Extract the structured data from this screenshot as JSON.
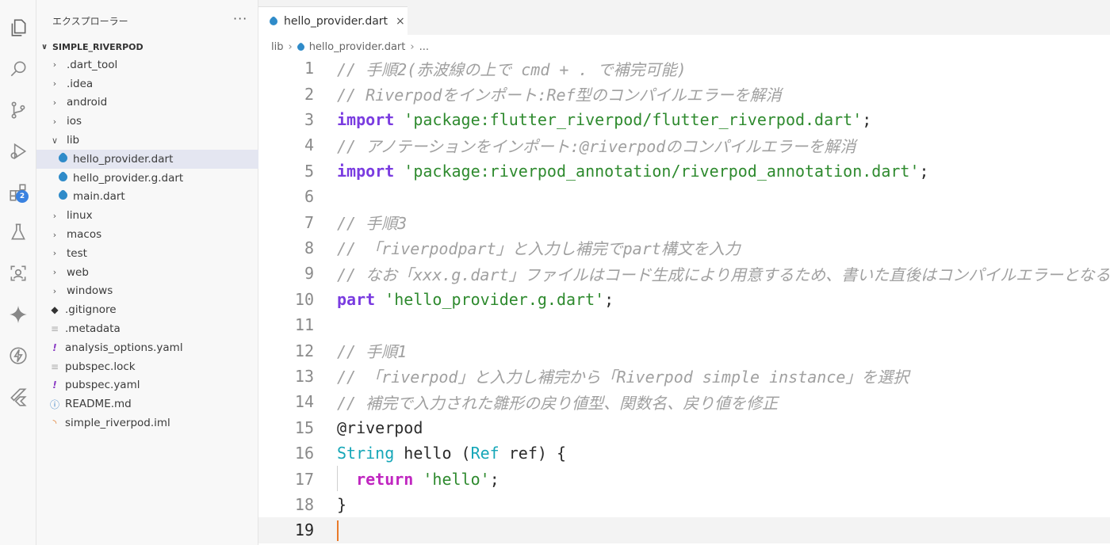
{
  "activity_bar": {
    "icons": [
      "files-icon",
      "search-icon",
      "source-control-icon",
      "run-debug-icon",
      "extensions-icon",
      "testing-icon",
      "remote-explorer-icon",
      "sparkle-icon",
      "lightning-icon",
      "flutter-icon"
    ],
    "extensions_badge": "2"
  },
  "sidebar": {
    "title": "エクスプローラー",
    "more": "···",
    "section": "SIMPLE_RIVERPOD",
    "items": [
      {
        "label": ".dart_tool",
        "type": "folder"
      },
      {
        "label": ".idea",
        "type": "folder"
      },
      {
        "label": "android",
        "type": "folder"
      },
      {
        "label": "ios",
        "type": "folder"
      },
      {
        "label": "lib",
        "type": "folder-open"
      },
      {
        "label": "hello_provider.dart",
        "type": "dart",
        "selected": true
      },
      {
        "label": "hello_provider.g.dart",
        "type": "dart"
      },
      {
        "label": "main.dart",
        "type": "dart"
      },
      {
        "label": "linux",
        "type": "folder"
      },
      {
        "label": "macos",
        "type": "folder"
      },
      {
        "label": "test",
        "type": "folder"
      },
      {
        "label": "web",
        "type": "folder"
      },
      {
        "label": "windows",
        "type": "folder"
      },
      {
        "label": ".gitignore",
        "type": "git"
      },
      {
        "label": ".metadata",
        "type": "text"
      },
      {
        "label": "analysis_options.yaml",
        "type": "yaml"
      },
      {
        "label": "pubspec.lock",
        "type": "text"
      },
      {
        "label": "pubspec.yaml",
        "type": "yaml"
      },
      {
        "label": "README.md",
        "type": "info"
      },
      {
        "label": "simple_riverpod.iml",
        "type": "rss"
      }
    ]
  },
  "editor": {
    "tab": {
      "label": "hello_provider.dart",
      "close": "×"
    },
    "breadcrumb": [
      "lib",
      "hello_provider.dart",
      "..."
    ],
    "lines": [
      {
        "n": "1",
        "t": "// 手順2(赤波線の上で cmd + . で補完可能)"
      },
      {
        "n": "2",
        "t": "// Riverpodをインポート:Ref型のコンパイルエラーを解消"
      },
      {
        "n": "3",
        "kw": "import",
        "str": "'package:flutter_riverpod/flutter_riverpod.dart'",
        "end": ";"
      },
      {
        "n": "4",
        "t": "// アノテーションをインポート:@riverpodのコンパイルエラーを解消"
      },
      {
        "n": "5",
        "kw": "import",
        "str": "'package:riverpod_annotation/riverpod_annotation.dart'",
        "end": ";"
      },
      {
        "n": "6"
      },
      {
        "n": "7",
        "t": "// 手順3"
      },
      {
        "n": "8",
        "t": "// 「riverpodpart」と入力し補完でpart構文を入力"
      },
      {
        "n": "9",
        "t": "// なお「xxx.g.dart」ファイルはコード生成により用意するため、書いた直後はコンパイルエラーとなる"
      },
      {
        "n": "10",
        "kw": "part",
        "str": "'hello_provider.g.dart'",
        "end": ";"
      },
      {
        "n": "11"
      },
      {
        "n": "12",
        "t": "// 手順1"
      },
      {
        "n": "13",
        "t": "// 「riverpod」と入力し補完から「Riverpod simple instance」を選択"
      },
      {
        "n": "14",
        "t": "// 補完で入力された雛形の戻り値型、関数名、戻り値を修正"
      },
      {
        "n": "15",
        "ann": "@riverpod"
      },
      {
        "n": "16",
        "type1": "String",
        "p1": " hello (",
        "type2": "Ref",
        "p2": " ref) {"
      },
      {
        "n": "17",
        "kw2": "return",
        "str": "'hello'",
        "end": ";"
      },
      {
        "n": "18",
        "p1": "}"
      },
      {
        "n": "19",
        "current": true
      }
    ]
  }
}
